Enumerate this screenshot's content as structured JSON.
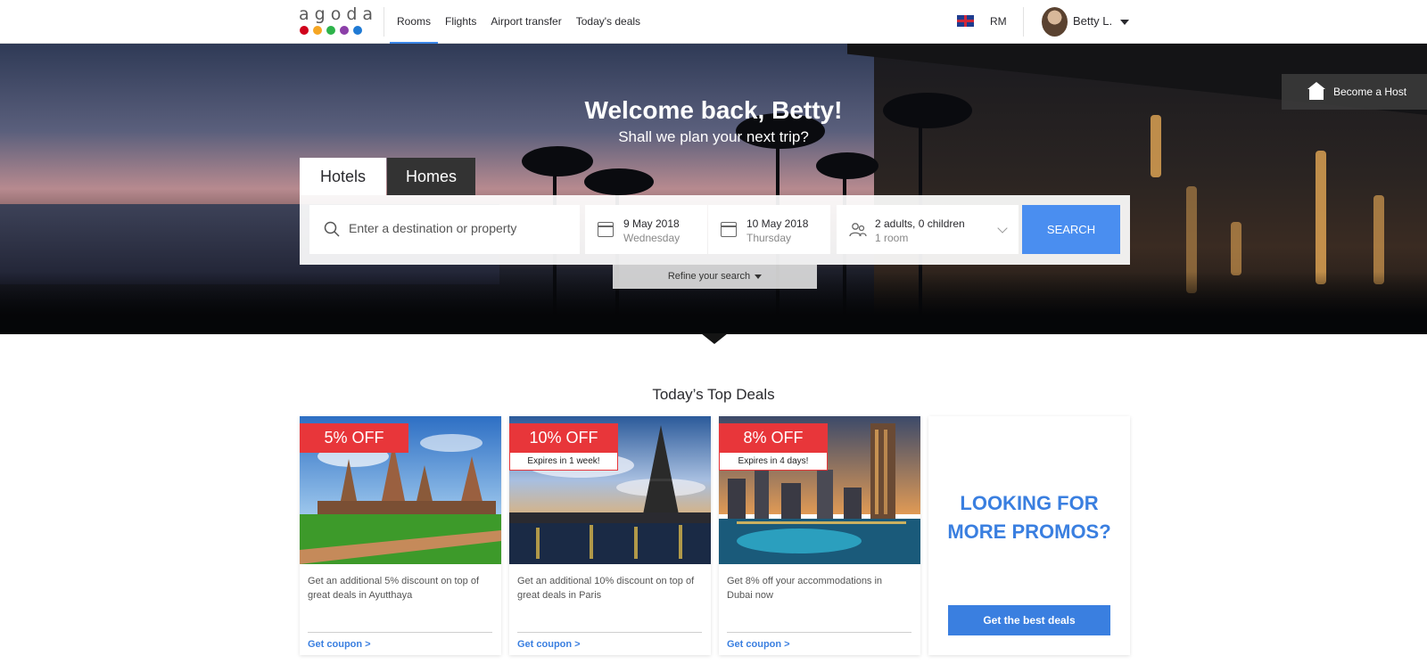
{
  "brand": {
    "logo_text": "agoda",
    "dot_colors": [
      "#d0021b",
      "#f5a623",
      "#2db34a",
      "#8b3fa8",
      "#1f7ad4"
    ]
  },
  "nav": {
    "links": [
      "Rooms",
      "Flights",
      "Airport transfer",
      "Today's deals"
    ],
    "active": "Rooms",
    "flag_icon": "uk-flag-icon",
    "currency": "RM",
    "user_name": "Betty L."
  },
  "hero": {
    "title": "Welcome back, Betty!",
    "subtitle": "Shall we plan your next trip?",
    "become_host": "Become a Host"
  },
  "search": {
    "tabs": [
      "Hotels",
      "Homes"
    ],
    "active_tab": "Hotels",
    "destination_placeholder": "Enter a destination or property",
    "checkin_date": "9 May 2018",
    "checkin_day": "Wednesday",
    "checkout_date": "10 May 2018",
    "checkout_day": "Thursday",
    "guests": "2 adults, 0 children",
    "rooms": "1 room",
    "search_label": "SEARCH",
    "refine_label": "Refine your search"
  },
  "deals": {
    "title": "Today’s Top Deals",
    "cards": [
      {
        "badge": "5% OFF",
        "expires": "",
        "description": "Get an additional 5% discount on top of great deals in Ayutthaya",
        "link": "Get coupon >"
      },
      {
        "badge": "10% OFF",
        "expires": "Expires in 1 week!",
        "description": "Get an additional 10% discount on top of great deals in Paris",
        "link": "Get coupon >"
      },
      {
        "badge": "8% OFF",
        "expires": "Expires in 4 days!",
        "description": "Get 8% off your accommodations in Dubai now",
        "link": "Get coupon >"
      }
    ],
    "promo_line1": "LOOKING FOR",
    "promo_line2": "MORE PROMOS?",
    "promo_button": "Get the best deals"
  },
  "colors": {
    "accent": "#3a7fe0",
    "search_button": "#4a8ef0",
    "deal_badge": "#e8363a"
  }
}
